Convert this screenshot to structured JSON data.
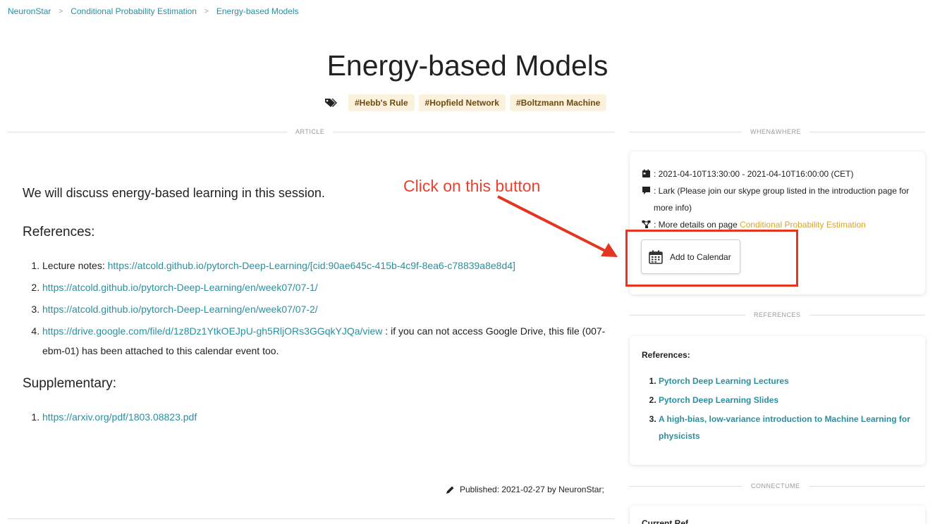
{
  "breadcrumb": {
    "items": [
      "NeuronStar",
      "Conditional Probability Estimation",
      "Energy-based Models"
    ],
    "separator": ">"
  },
  "page": {
    "title": "Energy-based Models",
    "tags": [
      "#Hebb's Rule",
      "#Hopfield Network",
      "#Boltzmann Machine"
    ]
  },
  "sections": {
    "article": "ARTICLE",
    "when_where": "WHEN&WHERE",
    "references": "REFERENCES",
    "connectume": "CONNECTUME"
  },
  "article": {
    "intro": "We will discuss energy-based learning in this session.",
    "references_heading": "References:",
    "ref1_prefix": "Lecture notes: ",
    "ref1_link": "https://atcold.github.io/pytorch-Deep-Learning/[cid:90ae645c-415b-4c9f-8ea6-c78839a8e8d4]",
    "ref2_link": "https://atcold.github.io/pytorch-Deep-Learning/en/week07/07-1/",
    "ref3_link": "https://atcold.github.io/pytorch-Deep-Learning/en/week07/07-2/",
    "ref4_link": "https://drive.google.com/file/d/1z8Dz1YtkOEJpU-gh5RljORs3GGqkYJQa/view",
    "ref4_suffix": " : if you can not access Google Drive, this file (007-ebm-01) has been attached to this calendar event too.",
    "supplementary_heading": "Supplementary:",
    "supp1_link": "https://arxiv.org/pdf/1803.08823.pdf",
    "published": "Published: 2021-02-27 by NeuronStar;"
  },
  "when": {
    "time": ": 2021-04-10T13:30:00 - 2021-04-10T16:00:00 (CET)",
    "location": ": Lark (Please join our skype group listed in the introduction page for more info)",
    "details_prefix": ": More details on page ",
    "details_link": "Conditional Probability Estimation",
    "add_calendar": "Add to Calendar"
  },
  "references_card": {
    "heading": "References:",
    "items": [
      "Pytorch Deep Learning Lectures",
      "Pytorch Deep Learning Slides",
      "A high-bias, low-variance introduction to Machine Learning for physicists"
    ]
  },
  "bottom_card": {
    "heading": "Current Ref..."
  },
  "annotation": {
    "text": "Click on this button"
  },
  "colors": {
    "link": "#2a8fa0",
    "gold_link": "#d9a52a",
    "tag_bg": "#fbf1dc",
    "annotation_red": "#e43521"
  },
  "icons": [
    "tags-icon",
    "calendar-icon",
    "comment-icon",
    "sitemap-icon",
    "pencil-icon"
  ]
}
